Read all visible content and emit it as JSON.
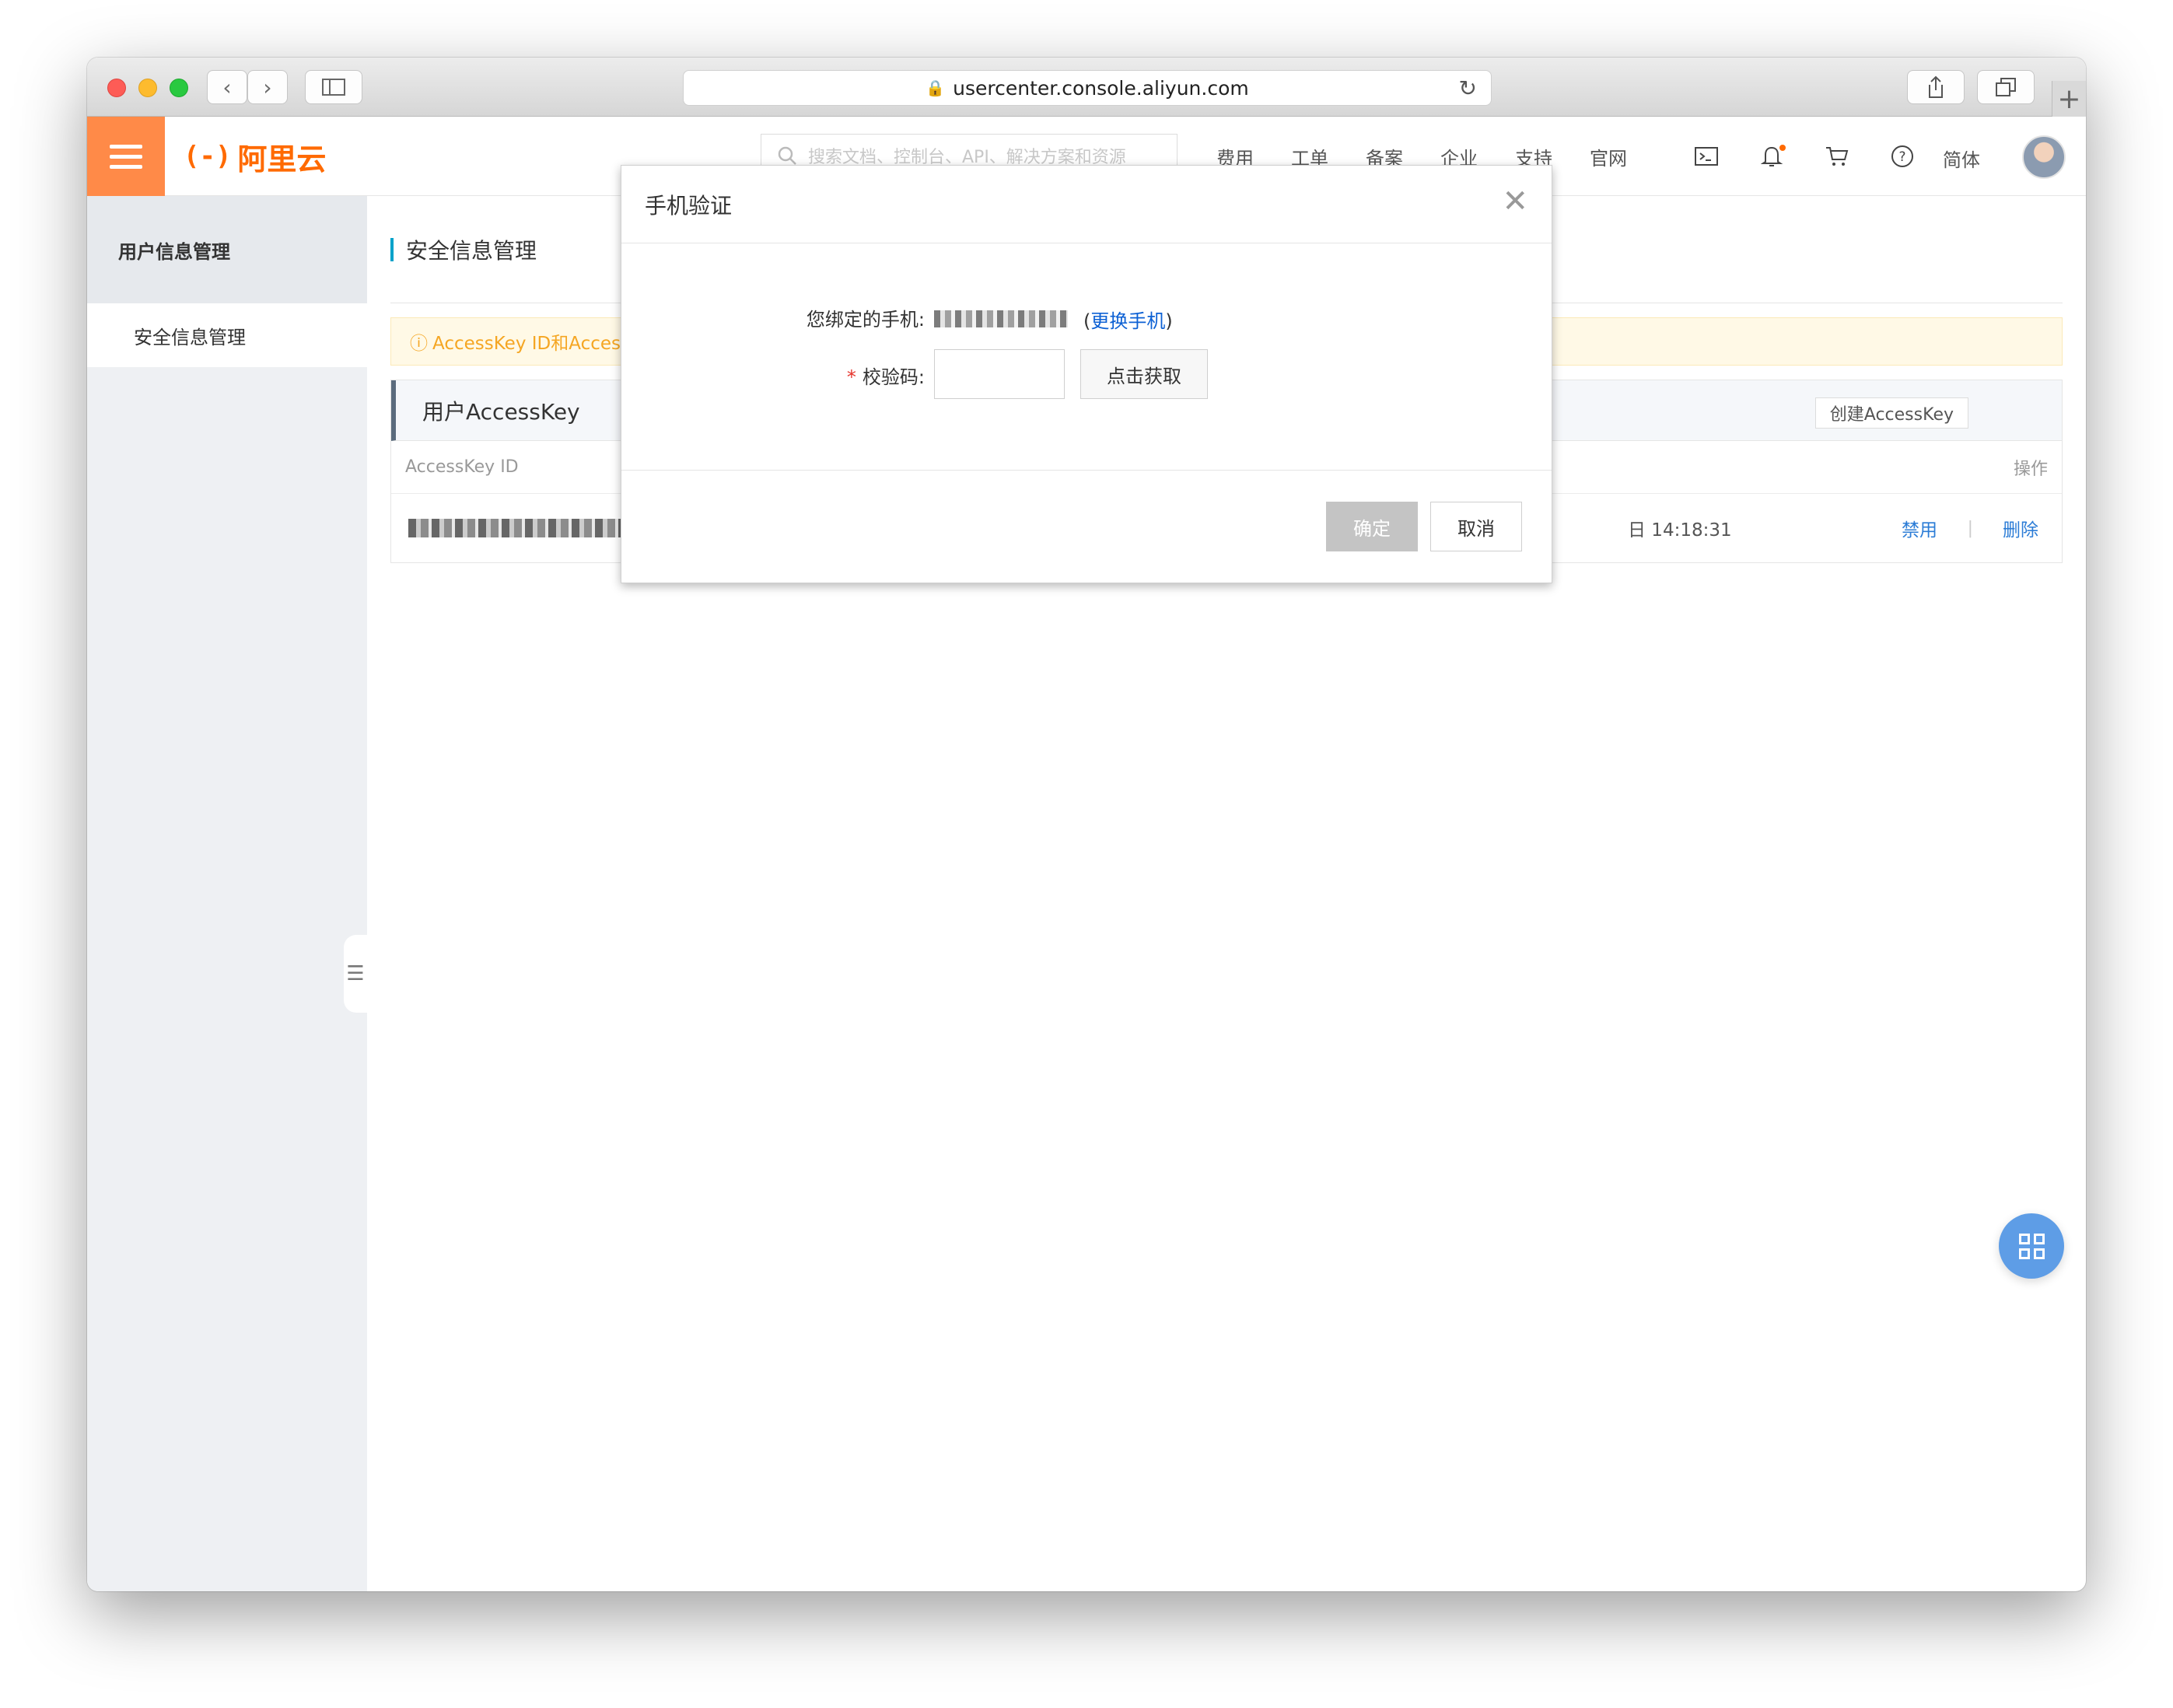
{
  "browser": {
    "url": "usercenter.console.aliyun.com",
    "lock_icon": "lock-icon",
    "reload_icon": "reload-icon",
    "new_tab": "+"
  },
  "header": {
    "logo_mark": "(-)",
    "logo_text": "阿里云",
    "search_placeholder": "搜索文档、控制台、API、解决方案和资源",
    "nav": [
      "费用",
      "工单",
      "备案",
      "企业",
      "支持",
      "官网"
    ],
    "language": "简体",
    "accent_color": "#ff8a48"
  },
  "sidebar": {
    "title": "用户信息管理",
    "items": [
      "安全信息管理"
    ]
  },
  "main": {
    "page_title": "安全信息管理",
    "warning": "AccessKey ID和Acces",
    "panel_title": "用户AccessKey",
    "create_button": "创建AccessKey",
    "columns": {
      "id": "AccessKey ID",
      "operation": "操作"
    },
    "row": {
      "time": "日 14:18:31",
      "disable": "禁用",
      "delete": "删除"
    }
  },
  "modal": {
    "title": "手机验证",
    "phone_label": "您绑定的手机:",
    "change_phone_open": "(",
    "change_phone_link": "更换手机",
    "change_phone_close": ")",
    "code_label": "校验码:",
    "required_mark": "*",
    "get_code_button": "点击获取",
    "ok_button": "确定",
    "cancel_button": "取消"
  }
}
